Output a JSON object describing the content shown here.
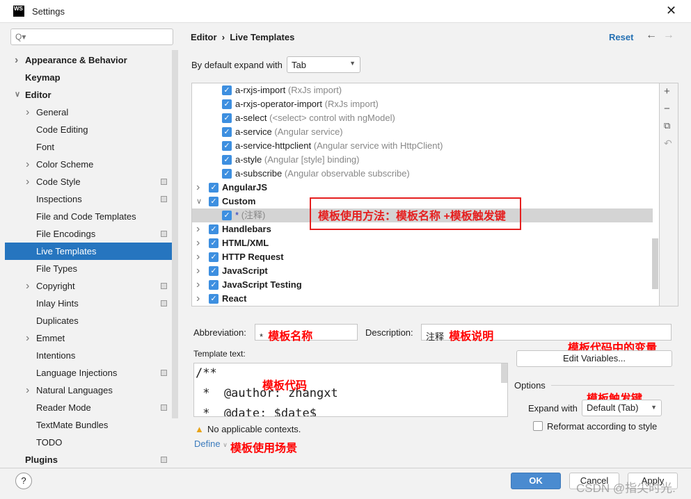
{
  "window": {
    "title": "Settings",
    "logo": "WS"
  },
  "search": {
    "placeholder": "Q▾"
  },
  "sidebar": {
    "items": [
      {
        "label": "Appearance & Behavior",
        "level": 0,
        "bold": true,
        "chevron": "right"
      },
      {
        "label": "Keymap",
        "level": 0,
        "bold": true
      },
      {
        "label": "Editor",
        "level": 0,
        "bold": true,
        "chevron": "down"
      },
      {
        "label": "General",
        "level": 1,
        "chevron": "right"
      },
      {
        "label": "Code Editing",
        "level": 1
      },
      {
        "label": "Font",
        "level": 1
      },
      {
        "label": "Color Scheme",
        "level": 1,
        "chevron": "right"
      },
      {
        "label": "Code Style",
        "level": 1,
        "chevron": "right",
        "badge": true
      },
      {
        "label": "Inspections",
        "level": 1,
        "badge": true
      },
      {
        "label": "File and Code Templates",
        "level": 1
      },
      {
        "label": "File Encodings",
        "level": 1,
        "badge": true
      },
      {
        "label": "Live Templates",
        "level": 1,
        "selected": true
      },
      {
        "label": "File Types",
        "level": 1
      },
      {
        "label": "Copyright",
        "level": 1,
        "chevron": "right",
        "badge": true
      },
      {
        "label": "Inlay Hints",
        "level": 1,
        "badge": true
      },
      {
        "label": "Duplicates",
        "level": 1
      },
      {
        "label": "Emmet",
        "level": 1,
        "chevron": "right"
      },
      {
        "label": "Intentions",
        "level": 1
      },
      {
        "label": "Language Injections",
        "level": 1,
        "badge": true
      },
      {
        "label": "Natural Languages",
        "level": 1,
        "chevron": "right"
      },
      {
        "label": "Reader Mode",
        "level": 1,
        "badge": true
      },
      {
        "label": "TextMate Bundles",
        "level": 1
      },
      {
        "label": "TODO",
        "level": 1
      },
      {
        "label": "Plugins",
        "level": 0,
        "bold": true,
        "badge": true
      }
    ]
  },
  "header": {
    "breadcrumb": [
      "Editor",
      "Live Templates"
    ],
    "reset": "Reset"
  },
  "expand_default": {
    "label": "By default expand with",
    "value": "Tab"
  },
  "tree": {
    "rows": [
      {
        "name": "a-rxjs-import",
        "desc": "(RxJs import)",
        "level": 1
      },
      {
        "name": "a-rxjs-operator-import",
        "desc": "(RxJs import)",
        "level": 1
      },
      {
        "name": "a-select",
        "desc": "(<select> control with ngModel)",
        "level": 1
      },
      {
        "name": "a-service",
        "desc": "(Angular service)",
        "level": 1
      },
      {
        "name": "a-service-httpclient",
        "desc": "(Angular service with HttpClient)",
        "level": 1
      },
      {
        "name": "a-style",
        "desc": "(Angular [style] binding)",
        "level": 1
      },
      {
        "name": "a-subscribe",
        "desc": "(Angular observable subscribe)",
        "level": 1
      },
      {
        "name": "AngularJS",
        "level": 0,
        "chevron": "right"
      },
      {
        "name": "Custom",
        "level": 0,
        "chevron": "down"
      },
      {
        "name": "*",
        "desc": "(注释)",
        "level": 1,
        "selected": true
      },
      {
        "name": "Handlebars",
        "level": 0,
        "chevron": "right"
      },
      {
        "name": "HTML/XML",
        "level": 0,
        "chevron": "right"
      },
      {
        "name": "HTTP Request",
        "level": 0,
        "chevron": "right"
      },
      {
        "name": "JavaScript",
        "level": 0,
        "chevron": "right"
      },
      {
        "name": "JavaScript Testing",
        "level": 0,
        "chevron": "right"
      },
      {
        "name": "React",
        "level": 0,
        "chevron": "right"
      }
    ]
  },
  "annotations": {
    "usage": "模板使用方法：模板名称 +模板触发键",
    "name": "模板名称",
    "desc": "模板说明",
    "vars": "模板代码中的变量",
    "code": "模板代码",
    "trigger": "模板触发键",
    "context": "模板使用场景"
  },
  "editor": {
    "abbreviation_label": "Abbreviation:",
    "abbreviation": "*",
    "description_label": "Description:",
    "description": "注释",
    "template_label": "Template text:",
    "template_lines": [
      "/**",
      " *  @author: zhangxt",
      " *  @date: $date$"
    ],
    "edit_vars": "Edit Variables...",
    "options": "Options",
    "expand_label": "Expand with",
    "expand_value": "Default (Tab)",
    "reformat": "Reformat according to style",
    "reformat_checked": false,
    "warning": "No applicable contexts.",
    "define": "Define"
  },
  "footer": {
    "help": "?",
    "ok": "OK",
    "cancel": "Cancel",
    "apply": "Apply",
    "watermark": "CSDN @指尖时光."
  },
  "colors": {
    "accent": "#2675bf",
    "annotation": "#ff0000"
  }
}
